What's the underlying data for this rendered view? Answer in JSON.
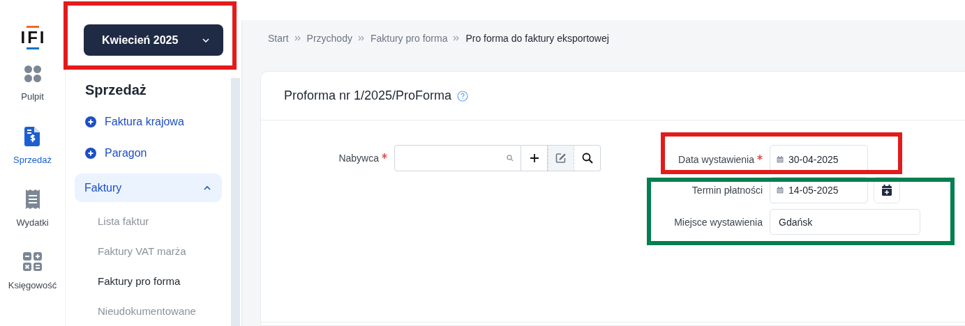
{
  "rail": {
    "logo": "IFI",
    "items": [
      {
        "label": "Pulpit",
        "selected": false
      },
      {
        "label": "Sprzedaż",
        "selected": true
      },
      {
        "label": "Wydatki",
        "selected": false
      },
      {
        "label": "Księgowość",
        "selected": false
      }
    ]
  },
  "month_button": {
    "label": "Kwiecień 2025"
  },
  "sidebar": {
    "title": "Sprzedaż",
    "actions": [
      "Faktura krajowa",
      "Paragon"
    ],
    "group": {
      "label": "Faktury",
      "expanded": true,
      "children": [
        {
          "label": "Lista faktur",
          "selected": false
        },
        {
          "label": "Faktury VAT marża",
          "selected": false
        },
        {
          "label": "Faktury pro forma",
          "selected": true
        },
        {
          "label": "Nieudokumentowane",
          "selected": false
        }
      ]
    }
  },
  "breadcrumb": [
    "Start",
    "Przychody",
    "Faktury pro forma",
    "Pro forma do faktury eksportowej"
  ],
  "card": {
    "title": "Proforma nr 1/2025/ProForma",
    "buyer": {
      "label": "Nabywca",
      "required": true
    },
    "fields": [
      {
        "label": "Data wystawienia",
        "required": true,
        "kind": "date",
        "value": "30-04-2025"
      },
      {
        "label": "Termin płatności",
        "required": false,
        "kind": "date-extra",
        "value": "14-05-2025"
      },
      {
        "label": "Miejsce wystawienia",
        "required": false,
        "kind": "text",
        "value": "Gdańsk"
      }
    ]
  },
  "annotations": [
    {
      "color": "#e31b1b"
    },
    {
      "color": "#e31b1b"
    },
    {
      "color": "#017f50"
    }
  ]
}
